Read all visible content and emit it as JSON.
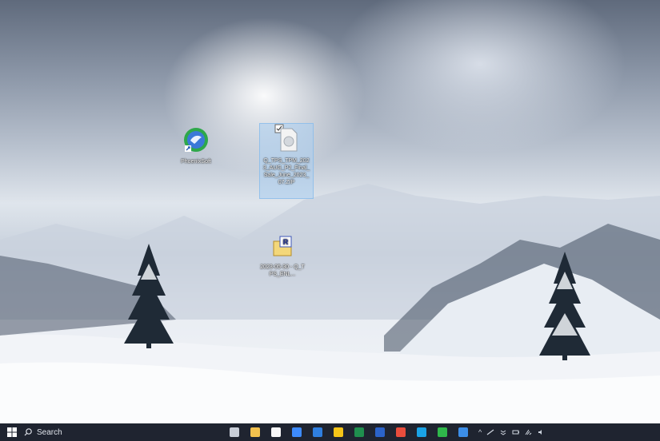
{
  "desktop": {
    "icons": [
      {
        "label": "PhoenixSoft",
        "icon": "globe-app-icon"
      },
      {
        "label": "Q_TPS_TPM_2023_AUG_P2_Final_Sale_June_2023_07.ZIP",
        "icon": "zip-file-icon"
      },
      {
        "label": "2023-05-30 - Q_TPS_ENL...",
        "icon": "r-document-icon"
      }
    ]
  },
  "taskbar": {
    "search_placeholder": "Search",
    "apps": [
      {
        "name": "task-view",
        "color": "#c8ced8"
      },
      {
        "name": "file-explorer",
        "color": "#f2c14e"
      },
      {
        "name": "store",
        "color": "#f7f7f7"
      },
      {
        "name": "dropbox",
        "color": "#3d8bfd"
      },
      {
        "name": "mail",
        "color": "#2f7fe0"
      },
      {
        "name": "sticky",
        "color": "#f5c518"
      },
      {
        "name": "excel",
        "color": "#1f8f4e"
      },
      {
        "name": "word",
        "color": "#2b63c9"
      },
      {
        "name": "chrome",
        "color": "#e94d3c"
      },
      {
        "name": "skype",
        "color": "#1aa3e6"
      },
      {
        "name": "wechat",
        "color": "#2fb84b"
      },
      {
        "name": "help",
        "color": "#3c8ee8"
      }
    ],
    "tray_chevron": "^"
  }
}
